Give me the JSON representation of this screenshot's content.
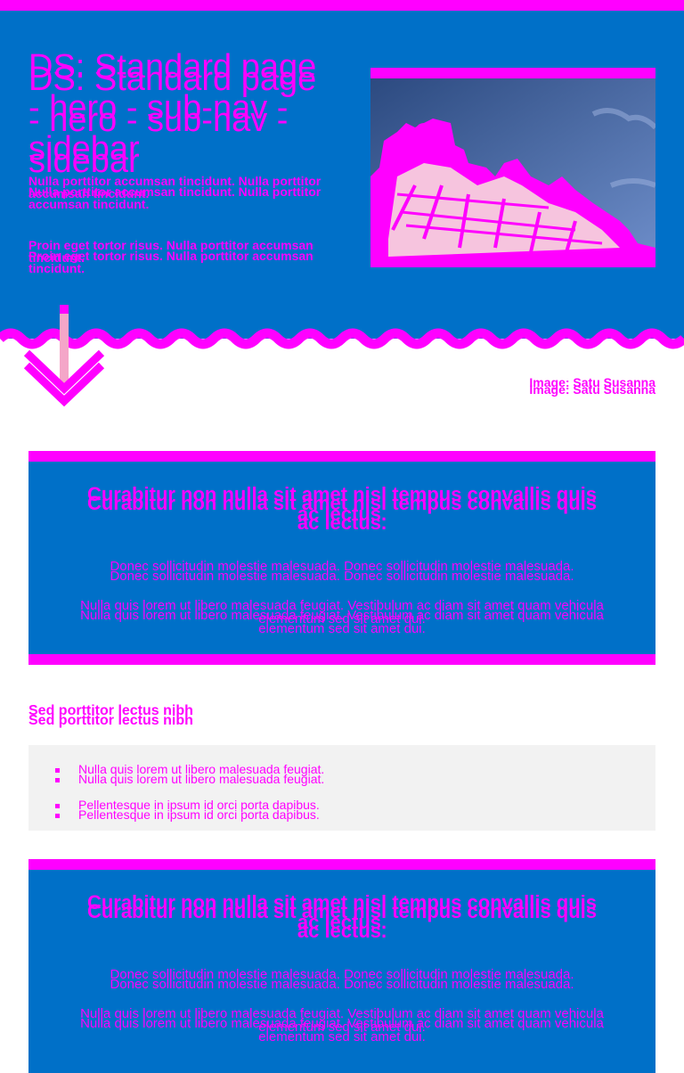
{
  "hero": {
    "title": "DS: Standard page - hero - sub-nav - sidebar",
    "paragraph_1": "Nulla porttitor accumsan tincidunt. Nulla porttitor accumsan tincidunt.",
    "paragraph_2": "Proin eget tortor risus. Nulla porttitor accumsan tincidunt.",
    "image_caption": "Image: Satu Susanna"
  },
  "callouts": [
    {
      "heading": "Curabitur non nulla sit amet nisl tempus convallis quis ac lectus.",
      "paragraph_1": "Donec sollicitudin molestie malesuada. Donec sollicitudin molestie malesuada.",
      "paragraph_2": "Nulla quis lorem ut libero malesuada feugiat. Vestibulum ac diam sit amet quam vehicula elementum sed sit amet dui."
    },
    {
      "heading": "Curabitur non nulla sit amet nisl tempus convallis quis ac lectus.",
      "paragraph_1": "Donec sollicitudin molestie malesuada. Donec sollicitudin molestie malesuada.",
      "paragraph_2": "Nulla quis lorem ut libero malesuada feugiat. Vestibulum ac diam sit amet quam vehicula elementum sed sit amet dui."
    }
  ],
  "list_section": {
    "heading": "Sed porttitor lectus nibh",
    "items": [
      "Nulla quis lorem ut libero malesuada feugiat.",
      "Pellentesque in ipsum id orci porta dapibus."
    ]
  },
  "colors": {
    "primary_blue": "#0070c8",
    "accent_magenta": "#ff00ff",
    "list_background": "#f2f2f2",
    "arrow_pink": "#f4a6c8"
  },
  "icons": {
    "scroll_indicator": "chevron-down-icon"
  }
}
